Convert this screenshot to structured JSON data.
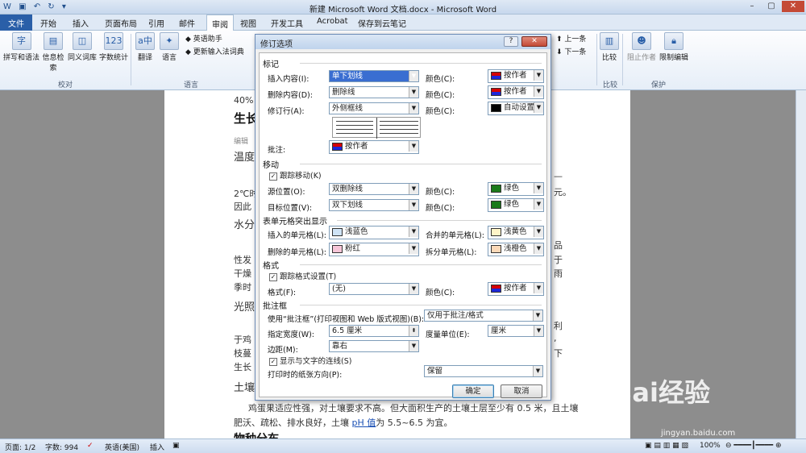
{
  "window": {
    "title": "新建 Microsoft Word 文档.docx - Microsoft Word"
  },
  "tabs": [
    "文件",
    "开始",
    "插入",
    "页面布局",
    "引用",
    "邮件",
    "审阅",
    "视图",
    "开发工具",
    "Acrobat",
    "保存到云笔记"
  ],
  "ribbon": {
    "proof": [
      "拼写和语法",
      "信息检索",
      "同义词库",
      "字数统计"
    ],
    "group_proof": "校对",
    "lang": [
      "翻译",
      "语言"
    ],
    "lang_small": [
      "英语助手",
      "更新输入法词典"
    ],
    "group_lang": "语言",
    "nav": [
      "上一条",
      "下一条"
    ],
    "compare": "比较",
    "group_compare": "比较",
    "block_authors": "阻止作者",
    "restrict": "限制编辑",
    "group_protect": "保护"
  },
  "doc": {
    "lines": [
      "40%",
      "生长",
      "编辑",
      "温度",
      "2℃时",
      "因此",
      "水分",
      "性发",
      "干燥",
      "季时",
      "光照",
      "于鸡",
      "枝蔓",
      "生长",
      "土壤"
    ],
    "right_lines": [
      "—",
      "元。",
      "品",
      "于",
      "雨",
      "利",
      ",",
      "下"
    ],
    "body_line1": "鸡蛋果适应性强，对土壤要求不高。但大面积生产的土壤土层至少有 0.5 米，且土壤",
    "body_line2_a": "肥沃、疏松、排水良好，土壤 ",
    "body_line2_link": "pH 值",
    "body_line2_b": "为 5.5~6.5 为宜。",
    "heading_bottom": "物种分布"
  },
  "dialog": {
    "title": "修订选项",
    "help": "?",
    "sec_mark": "标记",
    "insert_label": "插入内容(I):",
    "insert_value": "单下划线",
    "color_label": "颜色(C):",
    "by_author": "按作者",
    "delete_label": "删除内容(D):",
    "delete_value": "删除线",
    "changed_lines_label": "修订行(A):",
    "changed_lines_value": "外侧框线",
    "auto": "自动设置",
    "comments_label": "批注:",
    "sec_move": "移动",
    "track_moves": "跟踪移动(K)",
    "move_from_label": "源位置(O):",
    "move_from_value": "双删除线",
    "green": "绿色",
    "move_to_label": "目标位置(V):",
    "move_to_value": "双下划线",
    "sec_table": "表单元格突出显示",
    "inserted_cells_label": "插入的单元格(L):",
    "inserted_cells_value": "浅蓝色",
    "merged_cells_label": "合并的单元格(L):",
    "merged_cells_value": "浅黄色",
    "deleted_cells_label": "删除的单元格(L):",
    "deleted_cells_value": "粉红",
    "split_cells_label": "拆分单元格(L):",
    "split_cells_value": "浅橙色",
    "sec_format": "格式",
    "track_format": "跟踪格式设置(T)",
    "format_label": "格式(F):",
    "format_value": "(无)",
    "sec_balloons": "批注框",
    "use_balloons_label": "使用“批注框”(打印视图和 Web 版式视图)(B):",
    "use_balloons_value": "仅用于批注/格式",
    "width_label": "指定宽度(W):",
    "width_value": "6.5 厘米",
    "measure_label": "度量单位(E):",
    "measure_value": "厘米",
    "margin_label": "边距(M):",
    "margin_value": "靠右",
    "show_lines": "显示与文字的连线(S)",
    "paper_label": "打印时的纸张方向(P):",
    "paper_value": "保留",
    "ok": "确定",
    "cancel": "取消"
  },
  "status": {
    "page": "页面: 1/2",
    "words": "字数: 994",
    "lang": "英语(美国)",
    "insert": "插入",
    "zoom": "100%"
  },
  "watermark": {
    "brand": "Bai经验",
    "url": "jingyan.baidu.com"
  },
  "colors": {
    "author_red": "#d40000",
    "author_blue": "#1c27d8",
    "black": "#000000",
    "green": "#1a7a1a",
    "light_blue": "#cfe3f5",
    "light_yellow": "#fff4c8",
    "pink": "#f7c6d8",
    "light_orange": "#fbd9b8"
  }
}
